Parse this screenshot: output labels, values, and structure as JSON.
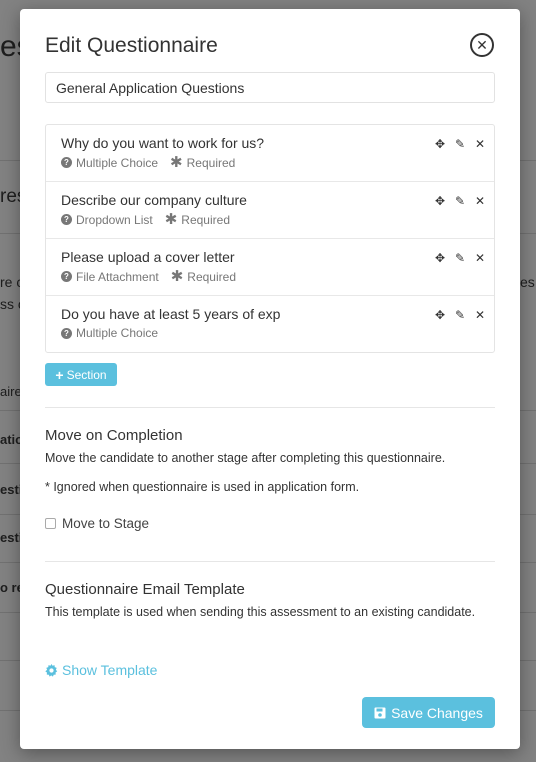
{
  "background_fragments": {
    "a": "es",
    "b": "res",
    "c": "re c",
    "d": "ss c",
    "e": "es",
    "f": "aire",
    "g": "atio",
    "h": "esti",
    "i": "esti",
    "j": "o re"
  },
  "modal": {
    "title": "Edit Questionnaire",
    "close_glyph": "✕",
    "name_value": "General Application Questions",
    "questions": [
      {
        "title": "Why do you want to work for us?",
        "type": "Multiple Choice",
        "required": "Required"
      },
      {
        "title": "Describe our company culture",
        "type": "Dropdown List",
        "required": "Required"
      },
      {
        "title": "Please upload a cover letter",
        "type": "File Attachment",
        "required": "Required"
      },
      {
        "title": "Do you have at least 5 years of exp",
        "type": "Multiple Choice",
        "required": ""
      }
    ],
    "section_button": "Section",
    "move_heading": "Move on Completion",
    "move_desc": "Move the candidate to another stage after completing this questionnaire.",
    "move_note": "* Ignored when questionnaire is used in application form.",
    "move_checkbox_label": "Move to Stage",
    "email_heading": "Questionnaire Email Template",
    "email_desc": "This template is used when sending this assessment to an existing candidate.",
    "show_template": "Show Template",
    "save_button": "Save Changes"
  },
  "colors": {
    "accent": "#5bc0de",
    "text": "#333333",
    "muted": "#777777"
  },
  "icons": {
    "move": "move-icon",
    "edit": "edit-icon",
    "delete": "close-icon",
    "gear": "gear-icon",
    "save": "floppy-disk-icon"
  }
}
